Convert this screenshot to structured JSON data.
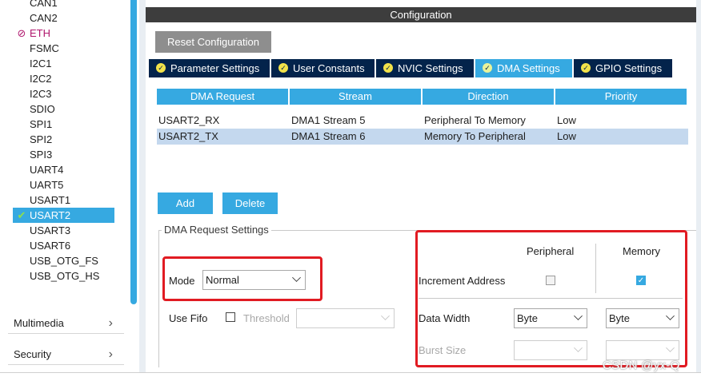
{
  "sidebar": {
    "peripherals": [
      {
        "label": "CAN1",
        "state": "normal"
      },
      {
        "label": "CAN2",
        "state": "normal"
      },
      {
        "label": "ETH",
        "state": "disabled",
        "icon": "no-entry-icon"
      },
      {
        "label": "FSMC",
        "state": "normal"
      },
      {
        "label": "I2C1",
        "state": "normal"
      },
      {
        "label": "I2C2",
        "state": "normal"
      },
      {
        "label": "I2C3",
        "state": "normal"
      },
      {
        "label": "SDIO",
        "state": "normal"
      },
      {
        "label": "SPI1",
        "state": "normal"
      },
      {
        "label": "SPI2",
        "state": "normal"
      },
      {
        "label": "SPI3",
        "state": "normal"
      },
      {
        "label": "UART4",
        "state": "normal"
      },
      {
        "label": "UART5",
        "state": "normal"
      },
      {
        "label": "USART1",
        "state": "normal"
      },
      {
        "label": "USART2",
        "state": "selected",
        "icon": "check-icon"
      },
      {
        "label": "USART3",
        "state": "normal"
      },
      {
        "label": "USART6",
        "state": "normal"
      },
      {
        "label": "USB_OTG_FS",
        "state": "normal"
      },
      {
        "label": "USB_OTG_HS",
        "state": "normal"
      }
    ],
    "categories": [
      {
        "label": "Multimedia"
      },
      {
        "label": "Security"
      }
    ]
  },
  "config": {
    "title": "Configuration",
    "reset_label": "Reset Configuration",
    "tabs": [
      {
        "label": "Parameter Settings",
        "active": false
      },
      {
        "label": "User Constants",
        "active": false
      },
      {
        "label": "NVIC Settings",
        "active": false
      },
      {
        "label": "DMA Settings",
        "active": true
      },
      {
        "label": "GPIO Settings",
        "active": false
      }
    ],
    "dma_table": {
      "columns": [
        "DMA Request",
        "Stream",
        "Direction",
        "Priority"
      ],
      "rows": [
        {
          "request": "USART2_RX",
          "stream": "DMA1 Stream 5",
          "direction": "Peripheral To Memory",
          "priority": "Low",
          "selected": false
        },
        {
          "request": "USART2_TX",
          "stream": "DMA1 Stream 6",
          "direction": "Memory To Peripheral",
          "priority": "Low",
          "selected": true
        }
      ]
    },
    "add_label": "Add",
    "delete_label": "Delete",
    "settings": {
      "legend": "DMA Request Settings",
      "mode_label": "Mode",
      "mode_value": "Normal",
      "use_fifo_label": "Use Fifo",
      "use_fifo_checked": false,
      "threshold_label": "Threshold",
      "threshold_value": "",
      "peripheral_header": "Peripheral",
      "memory_header": "Memory",
      "increment_label": "Increment Address",
      "peripheral_increment": false,
      "memory_increment": true,
      "data_width_label": "Data Width",
      "peripheral_width": "Byte",
      "memory_width": "Byte",
      "burst_label": "Burst Size",
      "peripheral_burst": "",
      "memory_burst": ""
    }
  },
  "watermark": "CSDN @yx-Q",
  "colors": {
    "accent": "#36a9e1",
    "tabbar": "#03234b",
    "title_bar": "#3d3d3d",
    "highlight_box": "#e11b22",
    "disabled_text": "#b0186e"
  }
}
